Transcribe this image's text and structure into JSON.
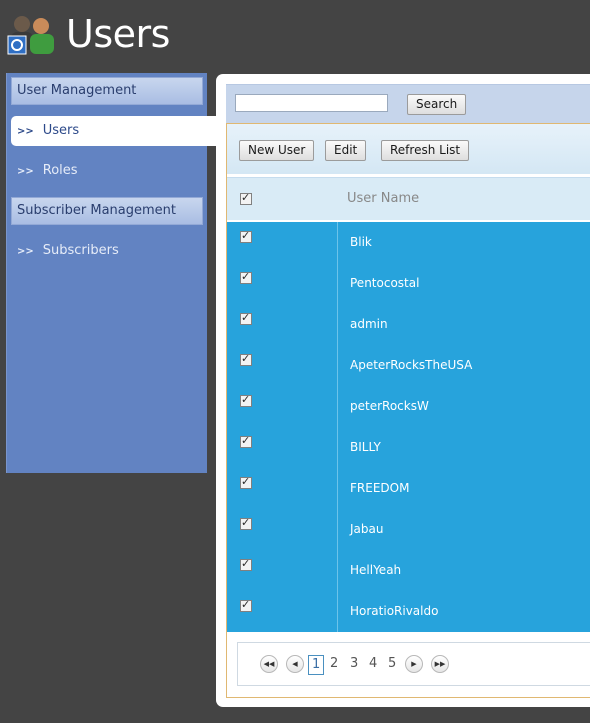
{
  "header": {
    "title": "Users",
    "icon": "users-admin-icon"
  },
  "sidebar": {
    "sections": [
      {
        "label": "User Management",
        "items": [
          {
            "label": "Users",
            "active": true
          },
          {
            "label": "Roles",
            "active": false
          }
        ]
      },
      {
        "label": "Subscriber Management",
        "items": [
          {
            "label": "Subscribers",
            "active": false
          }
        ]
      }
    ],
    "bullet": ">>"
  },
  "search": {
    "value": "",
    "placeholder": "",
    "button_label": "Search"
  },
  "toolbar": {
    "new_label": "New User",
    "edit_label": "Edit",
    "refresh_label": "Refresh List"
  },
  "grid": {
    "column_header": "User Name",
    "header_checked": true,
    "rows": [
      {
        "name": "Blik",
        "checked": true
      },
      {
        "name": "Pentocostal",
        "checked": true
      },
      {
        "name": "admin",
        "checked": true
      },
      {
        "name": "ApeterRocksTheUSA",
        "checked": true
      },
      {
        "name": "peterRocksW",
        "checked": true
      },
      {
        "name": "BILLY",
        "checked": true
      },
      {
        "name": "FREEDOM",
        "checked": true
      },
      {
        "name": "Jabau",
        "checked": true
      },
      {
        "name": "HellYeah",
        "checked": true
      },
      {
        "name": "HoratioRivaldo",
        "checked": true
      }
    ]
  },
  "pager": {
    "pages": [
      "1",
      "2",
      "3",
      "4",
      "5"
    ],
    "current": "1"
  },
  "colors": {
    "background": "#444444",
    "sidebar": "#6283c2",
    "row_selected": "#27a3dc",
    "accent_border": "#e0b872"
  }
}
